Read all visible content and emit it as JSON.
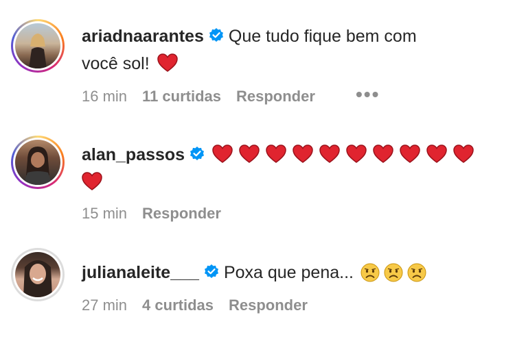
{
  "comments": [
    {
      "username": "ariadnaarantes",
      "verified": true,
      "text_line1": "Que tudo fique bem com",
      "text_line2": "você sol!",
      "emoji": [
        "heart"
      ],
      "time": "16 min",
      "likes": "11 curtidas",
      "reply": "Responder",
      "more": "•••"
    },
    {
      "username": "alan_passos",
      "verified": true,
      "text": "",
      "emoji_count": 11,
      "emoji": [
        "heart"
      ],
      "time": "15 min",
      "reply": "Responder"
    },
    {
      "username": "julianaleite___",
      "verified": true,
      "text": "Poxa que pena...",
      "emoji_count": 3,
      "emoji": [
        "sad-face"
      ],
      "time": "27 min",
      "likes": "4 curtidas",
      "reply": "Responder"
    }
  ],
  "colors": {
    "text": "#262626",
    "meta": "#8e8e8e",
    "verified": "#0095f6",
    "heart": "#e0242f"
  }
}
